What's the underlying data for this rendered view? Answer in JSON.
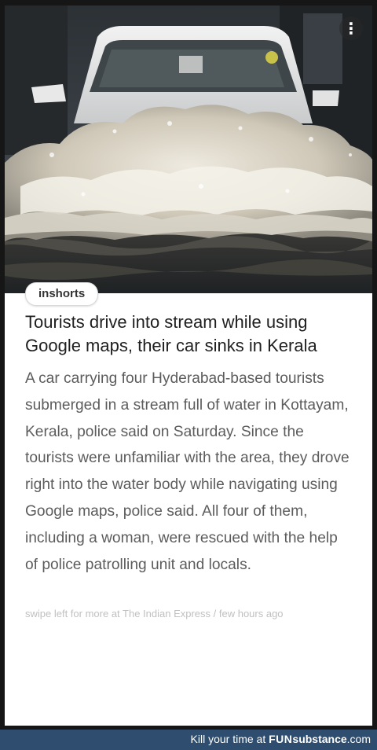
{
  "card": {
    "source_label": "inshorts",
    "info_icon": "info-dots-icon",
    "headline": "Tourists drive into stream while using Google maps, their car sinks in Kerala",
    "body": "A car carrying four Hyderabad-based tourists submerged in a stream full of water in Kottayam, Kerala, police said on Saturday. Since the tourists were unfamiliar with the area, they drove right into the water body while navigating using Google maps, police said. All four of them, including a woman, were rescued with the help of police patrolling unit and locals.",
    "footer": "swipe left for more at The Indian Express / few hours ago"
  },
  "watermark": {
    "prefix": "Kill your time at ",
    "brand_fun": "FUN",
    "brand_sub": "substance",
    "brand_com": ".com",
    "bar_color": "#2f4e6f"
  }
}
